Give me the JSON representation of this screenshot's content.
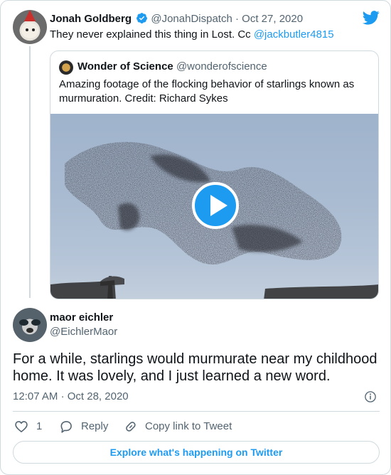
{
  "parent_tweet": {
    "author_name": "Jonah Goldberg",
    "handle": "@JonahDispatch",
    "separator": "·",
    "date": "Oct 27, 2020",
    "text": "They never explained this thing in Lost. Cc ",
    "mention": "@jackbutler4815"
  },
  "quoted_tweet": {
    "author_name": "Wonder of Science",
    "handle": "@wonderofscience",
    "text": "Amazing footage of the flocking behavior of starlings known as murmuration. Credit: Richard Sykes",
    "media": {
      "type": "video",
      "icon": "play-icon"
    }
  },
  "reply_tweet": {
    "author_name": "maor eichler",
    "handle": "@EichlerMaor",
    "text": "For a while, starlings would murmurate near my childhood home. It was lovely, and I just learned a new word.",
    "time": "12:07 AM",
    "separator": "·",
    "date": "Oct 28, 2020"
  },
  "actions": {
    "like_count": "1",
    "reply_label": "Reply",
    "copy_link_label": "Copy link to Tweet"
  },
  "footer": {
    "explore_label": "Explore what's happening on Twitter"
  },
  "colors": {
    "accent": "#1d9bf0",
    "muted": "#536471",
    "border": "#cfd9de",
    "text": "#0f1419"
  },
  "icons": [
    "verified-badge-icon",
    "twitter-bird-icon",
    "play-icon",
    "info-icon",
    "heart-icon",
    "reply-bubble-icon",
    "link-icon"
  ]
}
